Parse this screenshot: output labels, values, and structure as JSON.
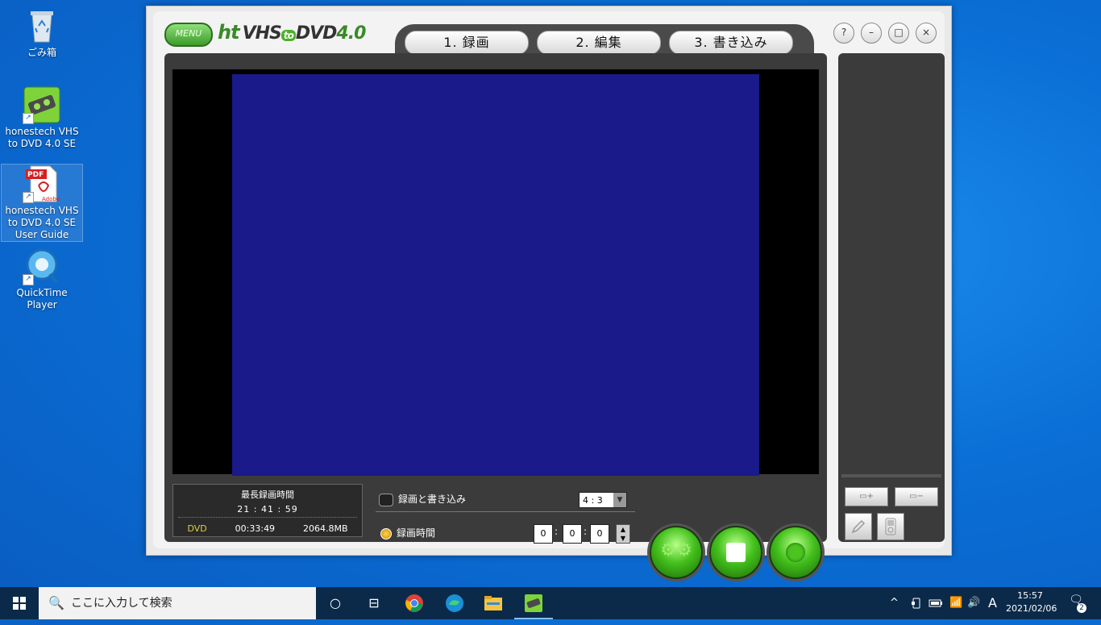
{
  "desktop": {
    "icons": [
      {
        "label": "ごみ箱",
        "icon": "recycle-bin-icon"
      },
      {
        "label": "honestech VHS to DVD 4.0 SE",
        "icon": "vhs-app-icon"
      },
      {
        "label": "honestech VHS to DVD 4.0 SE User Guide",
        "icon": "pdf-icon",
        "pdf_text": "PDF",
        "adobe_text": "Adobe"
      },
      {
        "label": "QuickTime Player",
        "icon": "quicktime-icon"
      }
    ],
    "shortcut_glyph": "↗"
  },
  "app": {
    "menu_label": "MENU",
    "logo": {
      "ht": "ht",
      "vhs": "VHS",
      "to": "to",
      "dvd": "DVD",
      "version": "4.0"
    },
    "tabs": [
      "1. 録画",
      "2. 編集",
      "3. 書き込み"
    ],
    "window_controls": {
      "help": "?",
      "minimize": "–",
      "maximize": "□",
      "close": "×"
    },
    "info": {
      "title": "最長録画時間",
      "max_time": "21 : 41 : 59",
      "format": "DVD",
      "duration": "00:33:49",
      "size": "2064.8MB"
    },
    "options": {
      "record_and_burn": "録画と書き込み",
      "record_time": "録画時間"
    },
    "aspect": {
      "value": "4 : 3",
      "arrow": "▼"
    },
    "timer": {
      "h": "0",
      "m": "0",
      "s": "0",
      "colon": ":",
      "spin_up": "▲",
      "spin_down": "▼"
    },
    "buttons": {
      "settings_glyph": "⚙⚙"
    },
    "side_buttons": {
      "add": "▭+",
      "remove": "▭−"
    },
    "colors": {
      "video_blue": "#1a1a8a",
      "accent_green": "#43c01c"
    }
  },
  "taskbar": {
    "search_placeholder": "ここに入力して検索",
    "search_icon": "🔍",
    "cortana": "○",
    "taskview": "⊟",
    "apps": [
      "chrome-icon",
      "edge-icon",
      "file-explorer-icon",
      "vhs-app-icon"
    ],
    "tray": {
      "chevron": "^",
      "ime": "A",
      "wifi": "📶",
      "volume": "🔊"
    },
    "clock": {
      "time": "15:57",
      "date": "2021/02/06"
    },
    "notifications": {
      "glyph": "🗨",
      "count": "2"
    }
  }
}
